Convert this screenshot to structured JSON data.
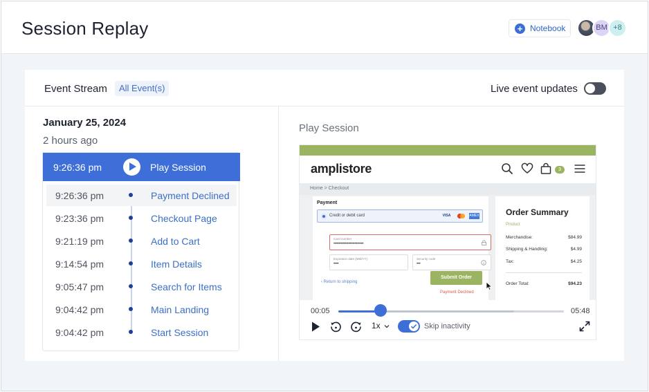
{
  "header": {
    "title": "Session Replay",
    "notebook_label": "Notebook",
    "avatars": [
      {
        "kind": "photo",
        "label": ""
      },
      {
        "kind": "initials",
        "label": "BM"
      },
      {
        "kind": "more",
        "label": "+8"
      }
    ]
  },
  "stream": {
    "title": "Event Stream",
    "filter_chip": "All Event(s)",
    "live_label": "Live event updates",
    "live_enabled": false,
    "date": "January 25, 2024",
    "relative_time": "2 hours ago",
    "play_row": {
      "time": "9:26:36 pm",
      "label": "Play Session"
    },
    "events": [
      {
        "time": "9:26:36 pm",
        "label": "Payment Declined"
      },
      {
        "time": "9:23:36 pm",
        "label": "Checkout Page"
      },
      {
        "time": "9:21:19 pm",
        "label": "Add to Cart"
      },
      {
        "time": "9:14:54 pm",
        "label": "Item Details"
      },
      {
        "time": "9:05:47 pm",
        "label": "Search for Items"
      },
      {
        "time": "9:04:42 pm",
        "label": "Main Landing"
      },
      {
        "time": "9:04:42 pm",
        "label": "Start Session"
      }
    ]
  },
  "player": {
    "title": "Play Session",
    "shop": {
      "brand": "amplistore",
      "cart_count": "3",
      "breadcrumb": "Home  >  Checkout",
      "payment_title": "Payment",
      "payment_option": "Credit or debit card",
      "card_brands": [
        "VISA",
        "MC",
        "AMEX"
      ],
      "card_number_label": "Card number",
      "card_number_value": "••••••••••••••••••••••••",
      "expiry_label": "Expiration date (MM/YY)",
      "expiry_value": "••••",
      "security_label": "Security code",
      "security_value": "•••",
      "return_link": "‹  Return to shipping",
      "submit_label": "Submit Order",
      "error_text": "Payment Declined",
      "order_summary": {
        "title": "Order Summary",
        "product_label": "Product",
        "rows": [
          {
            "label": "Merchandise:",
            "value": "$84.99"
          },
          {
            "label": "Shipping & Handling:",
            "value": "$4.99"
          },
          {
            "label": "Tax:",
            "value": "$4.25"
          }
        ],
        "total_label": "Order Total:",
        "total_value": "$94.23"
      }
    },
    "time_current": "00:05",
    "time_total": "05:48",
    "progress_fraction": 0.187,
    "buffered_fraction": 0.78,
    "speed": "1x",
    "skip_inactivity_label": "Skip inactivity",
    "skip_inactivity_enabled": true,
    "colors": {
      "accent": "#3e6fd8",
      "store_green": "#9ab461",
      "error": "#d45a4f"
    }
  }
}
